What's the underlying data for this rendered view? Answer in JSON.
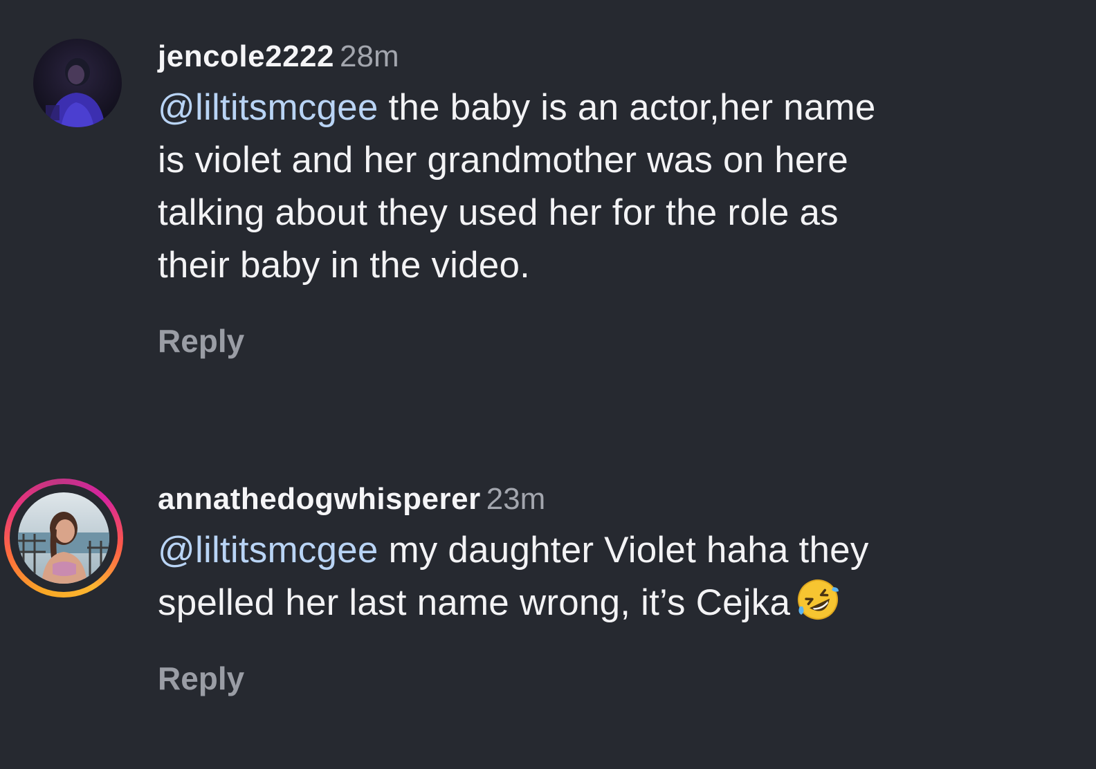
{
  "comments": [
    {
      "username": "jencole2222",
      "timestamp": "28m",
      "mention": "@liltitsmcgee",
      "text_lines": [
        " the baby is an actor,her name",
        "is violet and her grandmother was on here",
        "talking about they used her for the role as",
        "their baby in the video."
      ],
      "reply_label": "Reply",
      "has_story_ring": false
    },
    {
      "username": "annathedogwhisperer",
      "timestamp": "23m",
      "mention": "@liltitsmcgee",
      "text_lines": [
        " my daughter Violet haha they",
        "spelled her last name wrong, it’s Cejka"
      ],
      "emoji": "rolling-on-floor-laughing-emoji",
      "reply_label": "Reply",
      "has_story_ring": true
    }
  ],
  "colors": {
    "background": "#262930",
    "mention": "#b9d4f5",
    "timestamp": "#a3a6ae",
    "reply": "#9a9da5"
  }
}
